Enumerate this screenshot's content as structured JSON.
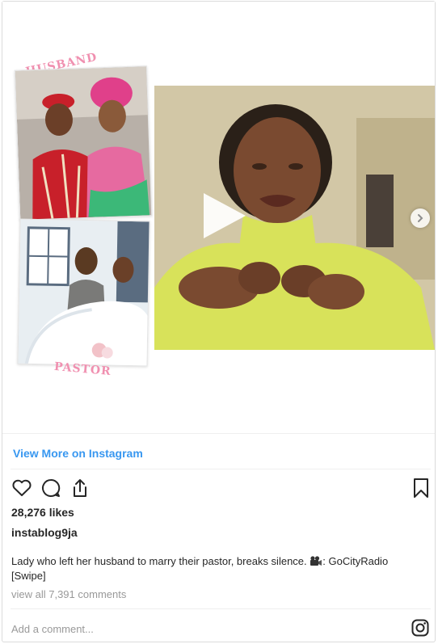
{
  "collage": {
    "label_husband": "HUSBAND",
    "label_pastor": "PASTOR"
  },
  "media": {
    "play_icon": "play-icon",
    "next_icon": "chevron-right-icon"
  },
  "link": {
    "view_more": "View More on Instagram"
  },
  "actions": {
    "like_icon": "heart-icon",
    "comment_icon": "comment-icon",
    "share_icon": "share-icon",
    "save_icon": "bookmark-icon"
  },
  "post": {
    "likes": "28,276 likes",
    "username": "instablog9ja",
    "caption_text": "Lady who left her husband to marry their pastor, breaks silence. ",
    "caption_credit": ": GoCityRadio",
    "caption_tail": "[Swipe]",
    "view_comments": "view all 7,391 comments"
  },
  "comment_box": {
    "placeholder": "Add a comment..."
  },
  "colors": {
    "link_blue": "#3897f0",
    "text": "#262626",
    "muted": "#999999",
    "border": "#dbdbdb",
    "label_pink": "#f090b0"
  }
}
